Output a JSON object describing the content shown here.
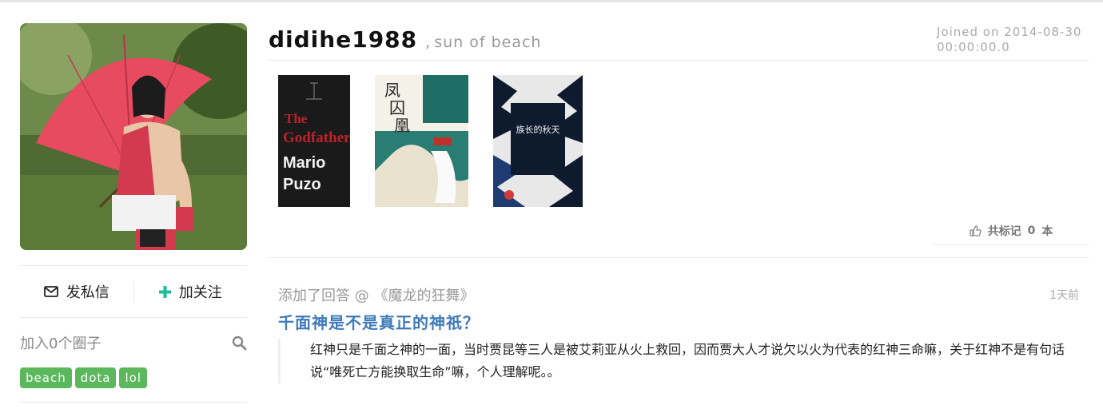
{
  "profile": {
    "username": "didihe1988",
    "separator": ",",
    "motto": "sun of beach",
    "joined": "Joined on 2014-08-30 00:00:00.0"
  },
  "actions": {
    "message_label": "发私信",
    "follow_label": "加关注"
  },
  "circles": {
    "label": "加入0个圈子",
    "tags": [
      "beach",
      "dota",
      "lol"
    ]
  },
  "books": [
    {
      "title": "The Godfather",
      "author": "Mario Puzo",
      "cover_color": "#1a1a1a"
    },
    {
      "title": "凤囚凰",
      "cover_color": "#f4f1e8"
    },
    {
      "title": "族长的秋天",
      "cover_color": "#0e1b2e"
    }
  ],
  "marks": {
    "label": "共标记",
    "count": "0",
    "unit": "本"
  },
  "feed": {
    "action": "添加了回答 @ 《魔龙的狂舞》",
    "time": "1天前",
    "title": "千面神是不是真正的神祇？",
    "body": "红神只是千面之神的一面，当时贾昆等三人是被艾莉亚从火上救回，因而贾大人才说欠以火为代表的红神三命嘛，关于红神不是有句话说“唯死亡方能换取生命”嘛，个人理解呢。。"
  },
  "colors": {
    "tag_green": "#5cb85c",
    "link_blue": "#3f7ab8",
    "follow_teal": "#1abc9c"
  }
}
